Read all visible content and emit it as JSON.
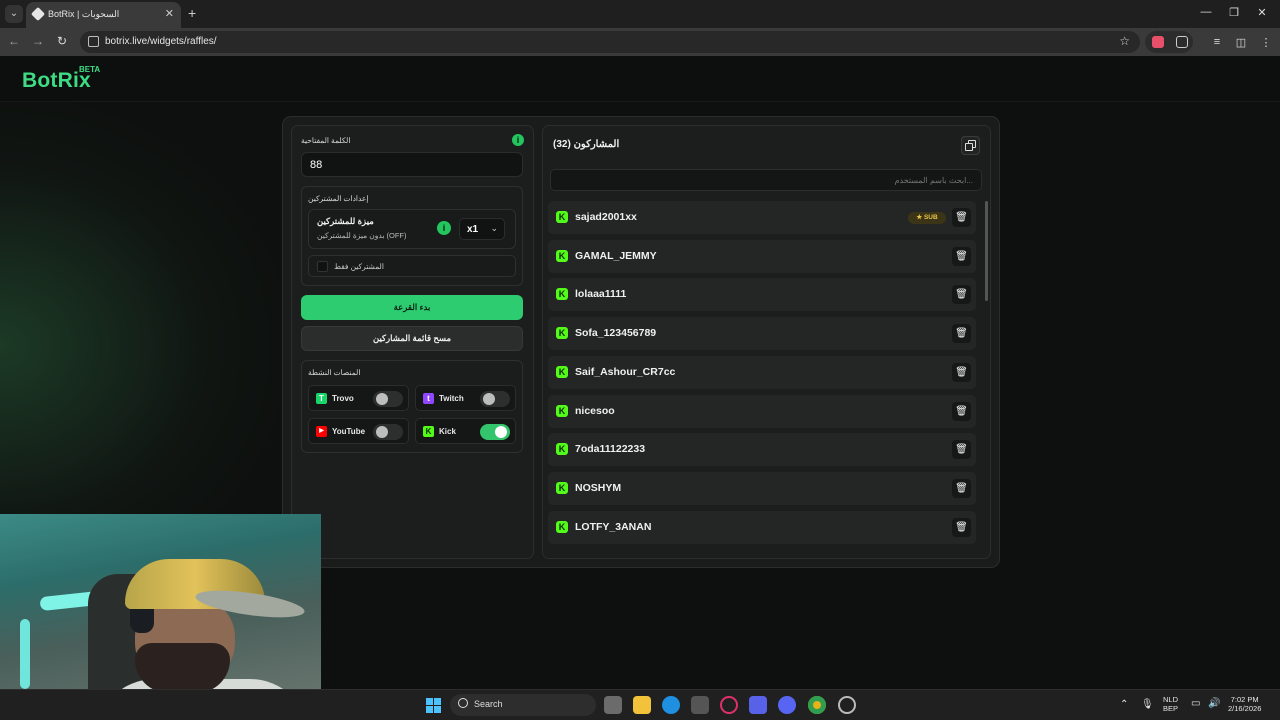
{
  "browser": {
    "tab_title": "BotRix | السحوبات",
    "url": "botrix.live/widgets/raffles/"
  },
  "site": {
    "logo": "BotRix",
    "badge": "BETA"
  },
  "raffle": {
    "keyword_label": "الكلمة المفتاحية",
    "keyword_value": "88",
    "subscriber_settings_label": "إعدادات المشتركين",
    "sub_feature_title": "ميزة للمشتركين",
    "sub_feature_desc": "بدون ميزة للمشتركين (OFF)",
    "multiplier": "x1",
    "subs_only_label": "المشتركين فقط",
    "start_button": "بدء القرعة",
    "clear_button": "مسح قائمة المشاركين",
    "platforms_label": "المنصات النشطة",
    "platforms": [
      {
        "name": "Trovo",
        "enabled": false,
        "color": "#19d66b"
      },
      {
        "name": "Twitch",
        "enabled": false,
        "color": "#9146ff"
      },
      {
        "name": "YouTube",
        "enabled": false,
        "color": "#ff0000"
      },
      {
        "name": "Kick",
        "enabled": true,
        "color": "#53fc18"
      }
    ]
  },
  "participants": {
    "title": "المشاركون (32)",
    "search_placeholder": "ابحث باسم المستخدم...",
    "sub_badge": "SUB",
    "items": [
      {
        "name": "sajad2001xx",
        "sub": true
      },
      {
        "name": "GAMAL_JEMMY",
        "sub": false
      },
      {
        "name": "lolaaa1111",
        "sub": false
      },
      {
        "name": "Sofa_123456789",
        "sub": false
      },
      {
        "name": "Saif_Ashour_CR7cc",
        "sub": false
      },
      {
        "name": "nicesoo",
        "sub": false
      },
      {
        "name": "7oda11122233",
        "sub": false
      },
      {
        "name": "NOSHYM",
        "sub": false
      },
      {
        "name": "LOTFY_3ANAN",
        "sub": false
      }
    ]
  },
  "taskbar": {
    "search": "Search",
    "lang_top": "NLD",
    "lang_bottom": "BEP",
    "time": "7:02 PM",
    "date": "2/16/2026"
  },
  "colors": {
    "accent": "#2ecc71",
    "kick": "#53fc18"
  }
}
